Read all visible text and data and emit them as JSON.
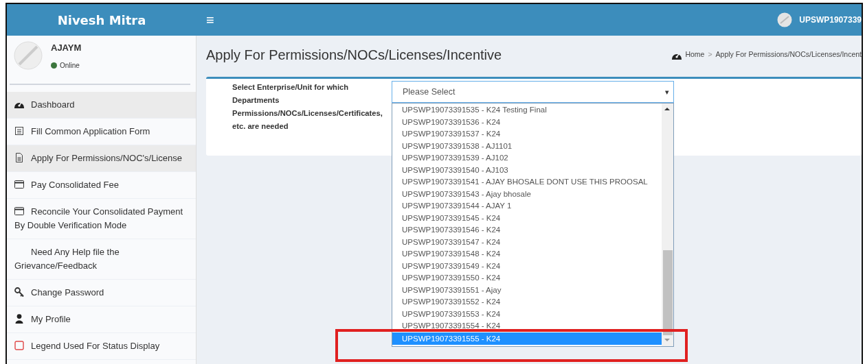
{
  "header": {
    "brand": "Nivesh Mitra",
    "menu_toggle": "≡",
    "user": "UPSWP1907339"
  },
  "user_panel": {
    "name": "AJAYM",
    "status": "Online",
    "online": true
  },
  "sidebar": {
    "items": [
      {
        "kind": "dashboard",
        "label": "Dashboard",
        "selected": true
      },
      {
        "kind": "form",
        "label": "Fill Common Application Form",
        "selected": false
      },
      {
        "kind": "file",
        "label": "Apply For Permissions/NOC's/License",
        "selected": true
      },
      {
        "kind": "card",
        "label": "Pay Consolidated Fee",
        "selected": false
      },
      {
        "kind": "card",
        "label": "Reconcile Your Consolidated Payment By Double Verification Mode",
        "selected": false
      },
      {
        "kind": "plain",
        "label": "Need Any Help file the Grievance/Feedback",
        "selected": false
      },
      {
        "kind": "key",
        "label": "Change Password",
        "selected": false
      },
      {
        "kind": "user",
        "label": "My Profile",
        "selected": false
      },
      {
        "kind": "legend",
        "label": "Legend Used For Status Display",
        "selected": false
      }
    ]
  },
  "page": {
    "title": "Apply For Permissions/NOCs/Licenses/Incentive",
    "breadcrumb": [
      "Home",
      "Apply For Permissions/NOCs/Licenses/Incent"
    ],
    "breadcrumb_separator": ">"
  },
  "form": {
    "label_lines": [
      "Select Enterprise/Unit for which",
      "Departments",
      "Permissions/NOCs/Licenses/Certificates,",
      "etc. are needed"
    ],
    "select": {
      "value": "Please Select",
      "caret": "▾",
      "expanded": true,
      "options": [
        {
          "label": "UPSWP19073391535 - K24 Testing Final",
          "selected": false
        },
        {
          "label": "UPSWP19073391536 - K24",
          "selected": false
        },
        {
          "label": "UPSWP19073391537 - K24",
          "selected": false
        },
        {
          "label": "UPSWP19073391538 - AJ1101",
          "selected": false
        },
        {
          "label": "UPSWP19073391539 - AJ102",
          "selected": false
        },
        {
          "label": "UPSWP19073391540 - AJ103",
          "selected": false
        },
        {
          "label": "UPSWP19073391541 - AJAY BHOSALE DONT USE THIS PROOSAL",
          "selected": false
        },
        {
          "label": "UPSWP19073391543 - Ajay bhosale",
          "selected": false
        },
        {
          "label": "UPSWP19073391544 - AJAY 1",
          "selected": false
        },
        {
          "label": "UPSWP19073391545 - K24",
          "selected": false
        },
        {
          "label": "UPSWP19073391546 - K24",
          "selected": false
        },
        {
          "label": "UPSWP19073391547 - K24",
          "selected": false
        },
        {
          "label": "UPSWP19073391548 - K24",
          "selected": false
        },
        {
          "label": "UPSWP19073391549 - K24",
          "selected": false
        },
        {
          "label": "UPSWP19073391550 - K24",
          "selected": false
        },
        {
          "label": "UPSWP19073391551 - Ajay",
          "selected": false
        },
        {
          "label": "UPSWP19073391552 - K24",
          "selected": false
        },
        {
          "label": "UPSWP19073391553 - K24",
          "selected": false
        },
        {
          "label": "UPSWP19073391554 - K24",
          "selected": false
        },
        {
          "label": "UPSWP19073391555 - K24",
          "selected": true
        }
      ]
    }
  }
}
